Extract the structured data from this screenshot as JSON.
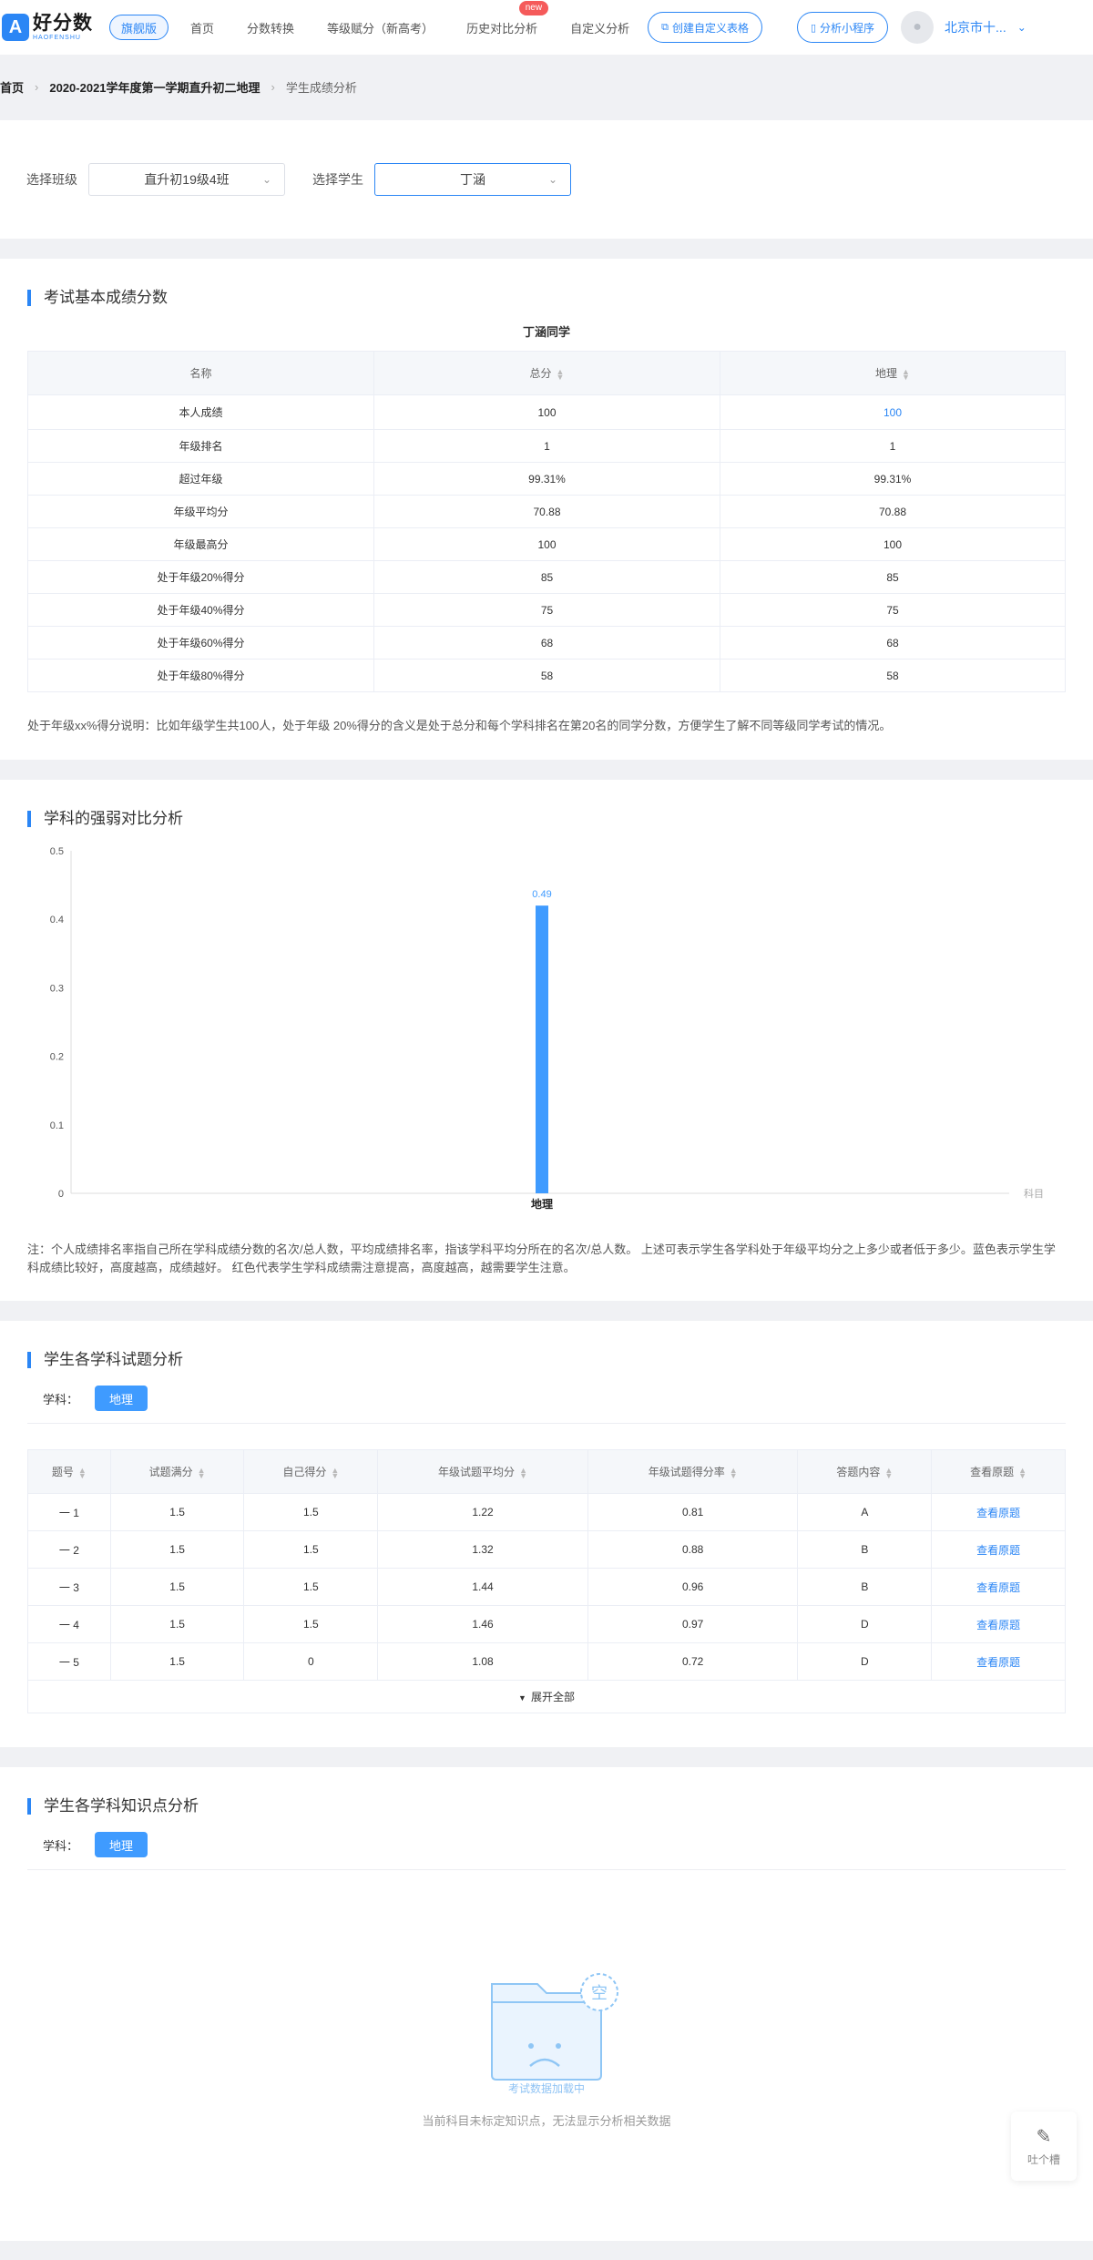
{
  "header": {
    "logo_cn": "好分数",
    "logo_en": "HAOFENSHU",
    "flagship_label": "旗舰版",
    "nav": [
      {
        "label": "首页"
      },
      {
        "label": "分数转换"
      },
      {
        "label": "等级赋分（新高考）"
      },
      {
        "label": "历史对比分析",
        "badge": "new"
      },
      {
        "label": "自定义分析"
      }
    ],
    "create_table_label": "创建自定义表格",
    "mini_program_label": "分析小程序",
    "user_name": "北京市十..."
  },
  "breadcrumb": {
    "home": "首页",
    "exam": "2020-2021学年度第一学期直升初二地理",
    "current": "学生成绩分析"
  },
  "filters": {
    "class_label": "选择班级",
    "class_value": "直升初19级4班",
    "student_label": "选择学生",
    "student_value": "丁涵"
  },
  "basic_scores": {
    "title": "考试基本成绩分数",
    "student_heading": "丁涵同学",
    "columns": [
      "名称",
      "总分",
      "地理"
    ],
    "rows": [
      [
        "本人成绩",
        "100",
        "100"
      ],
      [
        "年级排名",
        "1",
        "1"
      ],
      [
        "超过年级",
        "99.31%",
        "99.31%"
      ],
      [
        "年级平均分",
        "70.88",
        "70.88"
      ],
      [
        "年级最高分",
        "100",
        "100"
      ],
      [
        "处于年级20%得分",
        "85",
        "85"
      ],
      [
        "处于年级40%得分",
        "75",
        "75"
      ],
      [
        "处于年级60%得分",
        "68",
        "68"
      ],
      [
        "处于年级80%得分",
        "58",
        "58"
      ]
    ],
    "note": "处于年级xx%得分说明：比如年级学生共100人，处于年级 20%得分的含义是处于总分和每个学科排名在第20名的同学分数，方便学生了解不同等级同学考试的情况。"
  },
  "strength": {
    "title": "学科的强弱对比分析",
    "note": "注：个人成绩排名率指自己所在学科成绩分数的名次/总人数，平均成绩排名率，指该学科平均分所在的名次/总人数。 上述可表示学生各学科处于年级平均分之上多少或者低于多少。蓝色表示学生学科成绩比较好，高度越高，成绩越好。 红色代表学生学科成绩需注意提高，高度越高，越需要学生注意。"
  },
  "chart_data": {
    "type": "bar",
    "categories": [
      "地理"
    ],
    "values": [
      0.42
    ],
    "data_labels": [
      "0.49"
    ],
    "yticks": [
      "0",
      "0.1",
      "0.2",
      "0.3",
      "0.4",
      "0.5"
    ],
    "ylim": [
      0,
      0.5
    ],
    "xlabel": "科目",
    "ylabel": "",
    "title": "",
    "bar_color": "#3f9bff",
    "label_color": "#3f9bff",
    "grid": false
  },
  "questions": {
    "title": "学生各学科试题分析",
    "subject_label": "学科：",
    "subject": "地理",
    "columns": [
      "题号",
      "试题满分",
      "自己得分",
      "年级试题平均分",
      "年级试题得分率",
      "答题内容",
      "查看原题"
    ],
    "rows": [
      [
        "一 1",
        "1.5",
        "1.5",
        "1.22",
        "0.81",
        "A",
        "查看原题"
      ],
      [
        "一 2",
        "1.5",
        "1.5",
        "1.32",
        "0.88",
        "B",
        "查看原题"
      ],
      [
        "一 3",
        "1.5",
        "1.5",
        "1.44",
        "0.96",
        "B",
        "查看原题"
      ],
      [
        "一 4",
        "1.5",
        "1.5",
        "1.46",
        "0.97",
        "D",
        "查看原题"
      ],
      [
        "一 5",
        "1.5",
        "0",
        "1.08",
        "0.72",
        "D",
        "查看原题"
      ]
    ],
    "expand_label": "展开全部"
  },
  "knowledge": {
    "title": "学生各学科知识点分析",
    "subject_label": "学科：",
    "subject": "地理",
    "empty_badge": "空",
    "loading_text": "考试数据加载中",
    "empty_text": "当前科目未标定知识点，无法显示分析相关数据"
  },
  "float_button": {
    "label": "吐个槽"
  },
  "colors": {
    "accent": "#2b86f5",
    "new_badge": "#f55a5a"
  }
}
